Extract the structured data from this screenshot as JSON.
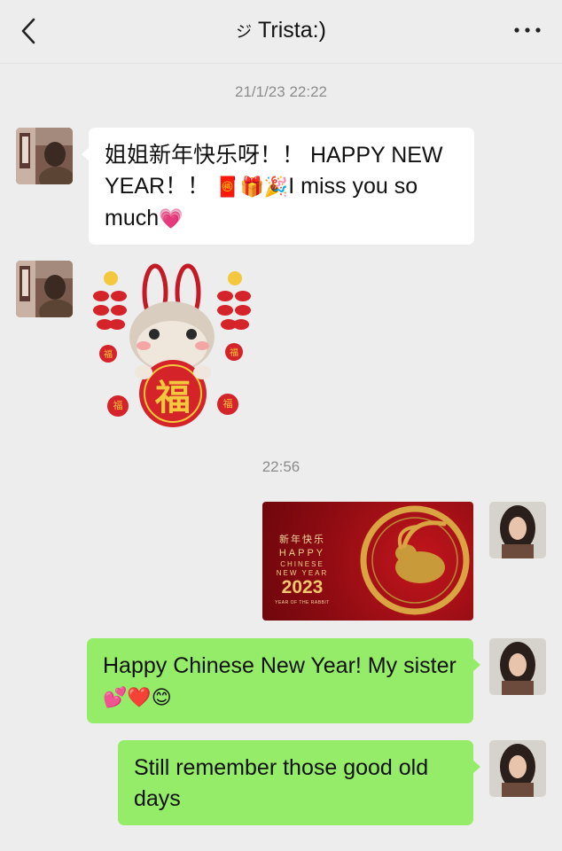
{
  "header": {
    "contact_name": "Trista:)",
    "name_prefix_symbol": "ジ",
    "back_icon": "chevron-left-icon",
    "more_icon": "more-dots-icon"
  },
  "timestamps": [
    "21/1/23 22:22",
    "22:56"
  ],
  "messages": [
    {
      "from": "contact",
      "type": "text",
      "text_a": "姐姐新年快乐呀！！ HAPPY NEW YEAR！！",
      "emojis_a": "🧧🎁🎉",
      "text_b": "I miss you so much",
      "emojis_b": "💗"
    },
    {
      "from": "contact",
      "type": "sticker",
      "glyph": "福",
      "mini_glyph": "福"
    },
    {
      "from": "me",
      "type": "image",
      "card": {
        "cn": "新年快乐",
        "happy": "HAPPY",
        "chinese": "CHINESE",
        "new_year": "NEW YEAR",
        "year": "2023",
        "sub": "YEAR OF THE RABBIT"
      }
    },
    {
      "from": "me",
      "type": "text",
      "text": "Happy Chinese New Year! My sister",
      "emojis": "💕❤️😊"
    },
    {
      "from": "me",
      "type": "text",
      "text": "Still remember those good old days"
    }
  ],
  "colors": {
    "background": "#ededed",
    "incoming_bubble": "#ffffff",
    "outgoing_bubble": "#95ec69",
    "timestamp": "#8c8c8c"
  }
}
